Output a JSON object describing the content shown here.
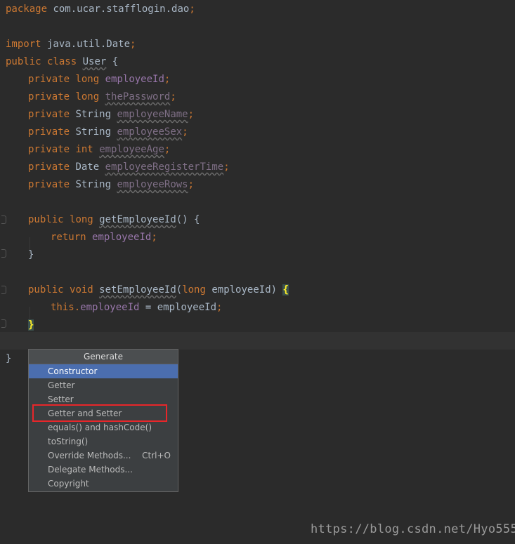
{
  "code": {
    "package_kw": "package",
    "package_name": " com.ucar.stafflogin.dao",
    "semi": ";",
    "import_kw": "import",
    "import_name": " java.util.Date",
    "public_kw": "public",
    "class_kw": "class",
    "class_name": "User",
    "open_brace": " {",
    "private_kw": "private",
    "long_kw": "long",
    "int_kw": "int",
    "void_kw": "void",
    "string_type": "String",
    "date_type": "Date",
    "return_kw": "return",
    "this_kw": "this",
    "fields": [
      "employeeId",
      "thePassword",
      "employeeName",
      "employeeSex",
      "employeeAge",
      "employeeRegisterTime",
      "employeeRows"
    ],
    "getter_name": "getEmployeeId",
    "getter_sig": "() {",
    "setter_name": "setEmployeeId",
    "setter_param_open": "(",
    "setter_param_name": " employeeId",
    "setter_param_close": ") ",
    "brace_open": "{",
    "brace_close": "}",
    "dot": ".",
    "assign_rhs": " = employeeId"
  },
  "popup": {
    "title": "Generate",
    "items": [
      {
        "label": "Constructor",
        "shortcut": ""
      },
      {
        "label": "Getter",
        "shortcut": ""
      },
      {
        "label": "Setter",
        "shortcut": ""
      },
      {
        "label": "Getter and Setter",
        "shortcut": ""
      },
      {
        "label": "equals() and hashCode()",
        "shortcut": ""
      },
      {
        "label": "toString()",
        "shortcut": ""
      },
      {
        "label": "Override Methods...",
        "shortcut": "Ctrl+O"
      },
      {
        "label": "Delegate Methods...",
        "shortcut": ""
      },
      {
        "label": "Copyright",
        "shortcut": ""
      }
    ],
    "selected_index": 0,
    "highlighted_label": "Getter and Setter"
  },
  "watermark": "https://blog.csdn.net/Hyo555",
  "colors": {
    "background": "#2b2b2b",
    "keyword": "#cc7832",
    "field": "#9876aa",
    "method": "#ffc66d",
    "selection": "#4b6eaf",
    "highlight_box": "#e8262a"
  }
}
